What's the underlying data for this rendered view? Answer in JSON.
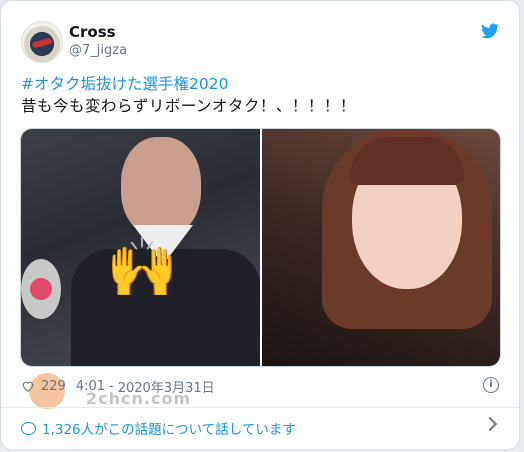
{
  "user": {
    "name": "Cross",
    "handle": "@7_jigza"
  },
  "tweet": {
    "hashtag": "#オタク垢抜けた選手権2020",
    "body": "昔も今も変わらずリボーンオタク！、！！！！"
  },
  "media": {
    "left_icon": "raised-hands-emoji",
    "right_icon": "photo"
  },
  "stats": {
    "likes": "229",
    "time": "4:01",
    "date": "2020年3月31日"
  },
  "talk": {
    "text": "1,326人がこの話題について話しています"
  },
  "watermark": {
    "text": "2chcn.com"
  },
  "colors": {
    "accent": "#1b95e0",
    "muted": "#657786"
  }
}
